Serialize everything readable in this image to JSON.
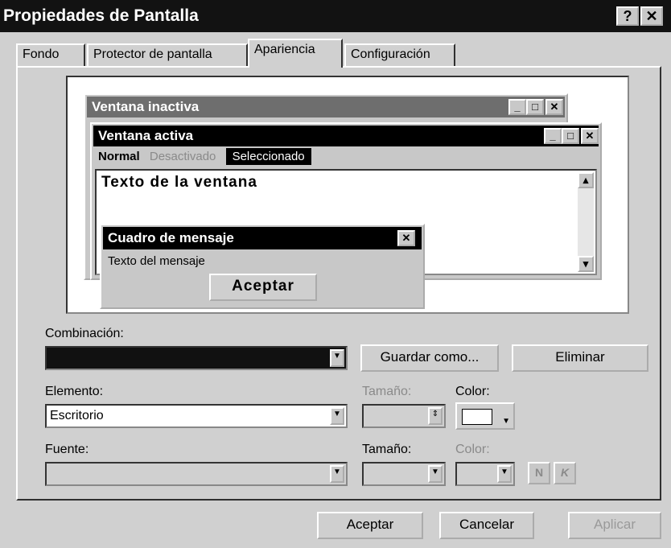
{
  "window": {
    "title": "Propiedades de Pantalla",
    "help_label": "?",
    "close_label": "✕"
  },
  "tabs": [
    {
      "label": "Fondo"
    },
    {
      "label": "Protector de pantalla"
    },
    {
      "label": "Apariencia"
    },
    {
      "label": "Configuración"
    }
  ],
  "preview": {
    "inactive_title": "Ventana inactiva",
    "active_title": "Ventana activa",
    "menu_normal": "Normal",
    "menu_disabled": "Desactivado",
    "menu_selected": "Seleccionado",
    "window_text": "Texto de la ventana",
    "msg_title": "Cuadro de mensaje",
    "msg_text": "Texto del mensaje",
    "msg_button": "Aceptar",
    "min_glyph": "_",
    "max_glyph": "□",
    "close_glyph": "✕",
    "scroll_up": "▴",
    "scroll_down": "▾"
  },
  "scheme": {
    "label": "Combinación:",
    "value": "",
    "save_label": "Guardar como...",
    "delete_label": "Eliminar"
  },
  "item": {
    "label": "Elemento:",
    "value": "Escritorio",
    "size_label": "Tamaño:",
    "color_label": "Color:"
  },
  "font": {
    "label": "Fuente:",
    "size_label": "Tamaño:",
    "color_label": "Color:",
    "bold_label": "N",
    "italic_label": "K"
  },
  "footer": {
    "ok_label": "Aceptar",
    "cancel_label": "Cancelar",
    "apply_label": "Aplicar"
  },
  "colors": {
    "active_title": "#000000",
    "inactive_title": "#6e6e6e",
    "desktop": "#ffffff",
    "selected": "#000000"
  }
}
